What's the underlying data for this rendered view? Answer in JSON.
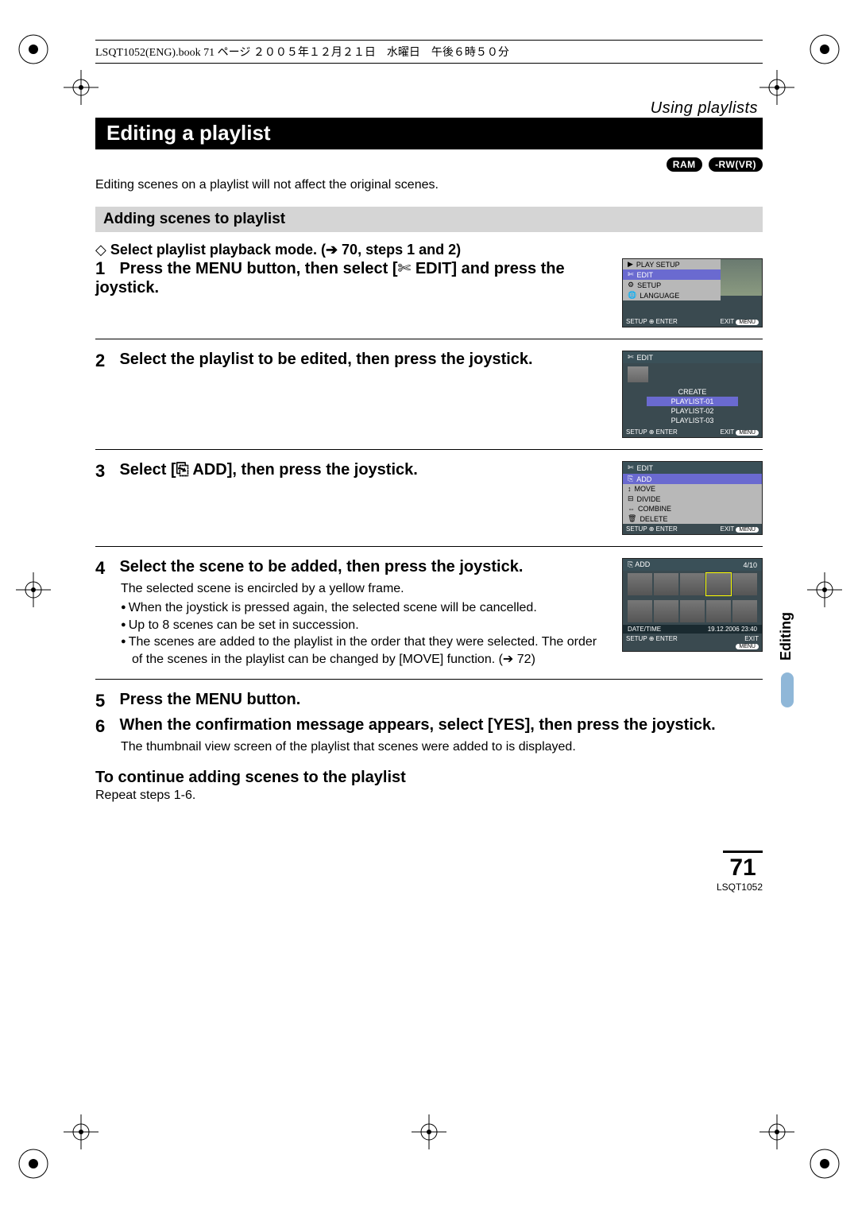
{
  "header_line": "LSQT1052(ENG).book  71 ページ  ２００５年１２月２１日　水曜日　午後６時５０分",
  "section": "Using playlists",
  "title": "Editing a playlist",
  "badges": [
    "RAM",
    "-RW(VR)"
  ],
  "intro": "Editing scenes on a playlist will not affect the original scenes.",
  "subsection": "Adding scenes to playlist",
  "preselect": "Select playlist playback mode. (➔ 70, steps 1 and 2)",
  "step1": {
    "num": "1",
    "title_a": "Press the MENU button, then select [",
    "title_icon_label": "✄",
    "title_b": " EDIT] and press the joystick.",
    "screen": {
      "rows": [
        "PLAY SETUP",
        "EDIT",
        "SETUP",
        "LANGUAGE"
      ],
      "foot_left": "SETUP ⊕ ENTER",
      "foot_right": "EXIT",
      "foot_pill": "MENU"
    }
  },
  "step2": {
    "num": "2",
    "title": "Select the playlist to be edited, then press the joystick.",
    "screen": {
      "head": "EDIT",
      "create": "CREATE",
      "items": [
        "PLAYLIST-01",
        "PLAYLIST-02",
        "PLAYLIST-03"
      ],
      "foot_left": "SETUP ⊕ ENTER",
      "foot_right": "EXIT",
      "foot_pill": "MENU"
    }
  },
  "step3": {
    "num": "3",
    "title_a": "Select [",
    "title_icon_label": "⎘",
    "title_b": " ADD], then press the joystick.",
    "screen": {
      "head": "EDIT",
      "rows": [
        "ADD",
        "MOVE",
        "DIVIDE",
        "COMBINE",
        "DELETE"
      ],
      "foot_left": "SETUP ⊕ ENTER",
      "foot_right": "EXIT",
      "foot_pill": "MENU"
    }
  },
  "step4": {
    "num": "4",
    "title": "Select the scene to be added, then press the joystick.",
    "note": "The selected scene is encircled by a yellow frame.",
    "bullets": [
      "When the joystick is pressed again, the selected scene will be cancelled.",
      "Up to 8 scenes can be set in succession.",
      "The scenes are added to the playlist in the order that they were selected. The order of the scenes in the playlist can be changed by [MOVE] function. (➔ 72)"
    ],
    "screen": {
      "head": "ADD",
      "count": "4/10",
      "date_label": "DATE/TIME",
      "date_val": "19.12.2006 23:40",
      "foot_left": "SETUP ⊕ ENTER",
      "foot_right_top": "EXIT",
      "foot_pill": "MENU"
    }
  },
  "step5": {
    "num": "5",
    "title": "Press the MENU button."
  },
  "step6": {
    "num": "6",
    "title": "When the confirmation message appears, select [YES], then press the joystick.",
    "note": "The thumbnail view screen of the playlist that scenes were added to is displayed."
  },
  "continue_head": "To continue adding scenes to the playlist",
  "continue_body": "Repeat steps 1-6.",
  "side_tab": "Editing",
  "page_number": "71",
  "doc_code": "LSQT1052"
}
